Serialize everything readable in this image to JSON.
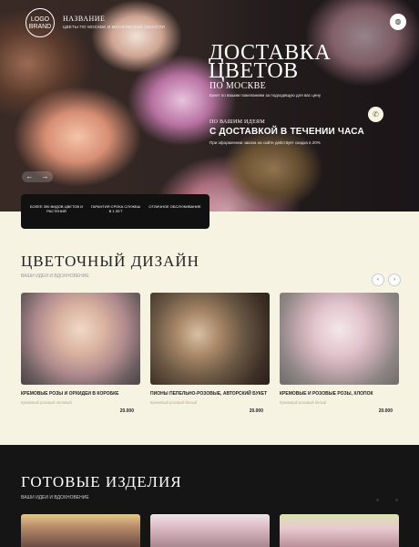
{
  "header": {
    "logo_line1": "LOGO",
    "logo_line2": "BRAND",
    "brand_name": "НАЗВАНИЕ",
    "brand_sub": "ЦВЕТЫ ПО МОСКВЕ И МОСКОВСКОЙ ОБЛАСТИ",
    "menu_icon": "menu-icon"
  },
  "hero": {
    "title_line1": "ДОСТАВКА",
    "title_line2": "ЦВЕТОВ",
    "place": "ПО МОСКВЕ",
    "note": "Букет по вашим пожеланиям за подходящую для вас цену",
    "promo_kicker": "ПО ВАШИМ ИДЕЯМ",
    "promo_title": "С ДОСТАВКОЙ В ТЕЧЕНИИ ЧАСА",
    "promo_note": "При оформлении заказа на сайте действует скидка в 20%",
    "phone_icon": "phone-icon",
    "prev_arrow": "←",
    "next_arrow": "→"
  },
  "features": [
    {
      "text": "БОЛЕЕ 390 ВИДОВ ЦВЕТОВ И РАСТЕНИЙ"
    },
    {
      "text": "ГАРАНТИЯ СРОКА СЛУЖБЫ В 1 ЛЕТ"
    },
    {
      "text": "ОТЛИЧНОЕ ОБСЛУЖИВАНИЕ"
    }
  ],
  "design_section": {
    "title": "ЦВЕТОЧНЫЙ ДИЗАЙН",
    "subtitle": "ВАШИ ИДЕИ И ВДОХНОВЕНИЕ",
    "prev": "‹",
    "next": "›",
    "cards": [
      {
        "name": "КРЕМОВЫЕ РОЗЫ И ОРХИДЕИ В КОРОБКЕ",
        "desc": "Кремовый розовый лиловый",
        "price": "20.000"
      },
      {
        "name": "ПИОНЫ  ПЕПЕЛЬНО-РОЗОВЫЕ, АВТОРСКИЙ БУКЕТ",
        "desc": "Кремовый розовый белый",
        "price": "20.000"
      },
      {
        "name": "КРЕМОВЫЕ И РОЗОВЫЕ РОЗЫ, ХЛОПОК",
        "desc": "Кремовый розовый белый",
        "price": "20.000"
      }
    ]
  },
  "ready_section": {
    "title": "ГОТОВЫЕ ИЗДЕЛИЯ",
    "subtitle": "ВАШИ ИДЕИ И ВДОХНОВЕНИЕ"
  },
  "colors": {
    "background": "#f6f3e2",
    "dark": "#151515",
    "accent_green": "#5a6a3a"
  }
}
